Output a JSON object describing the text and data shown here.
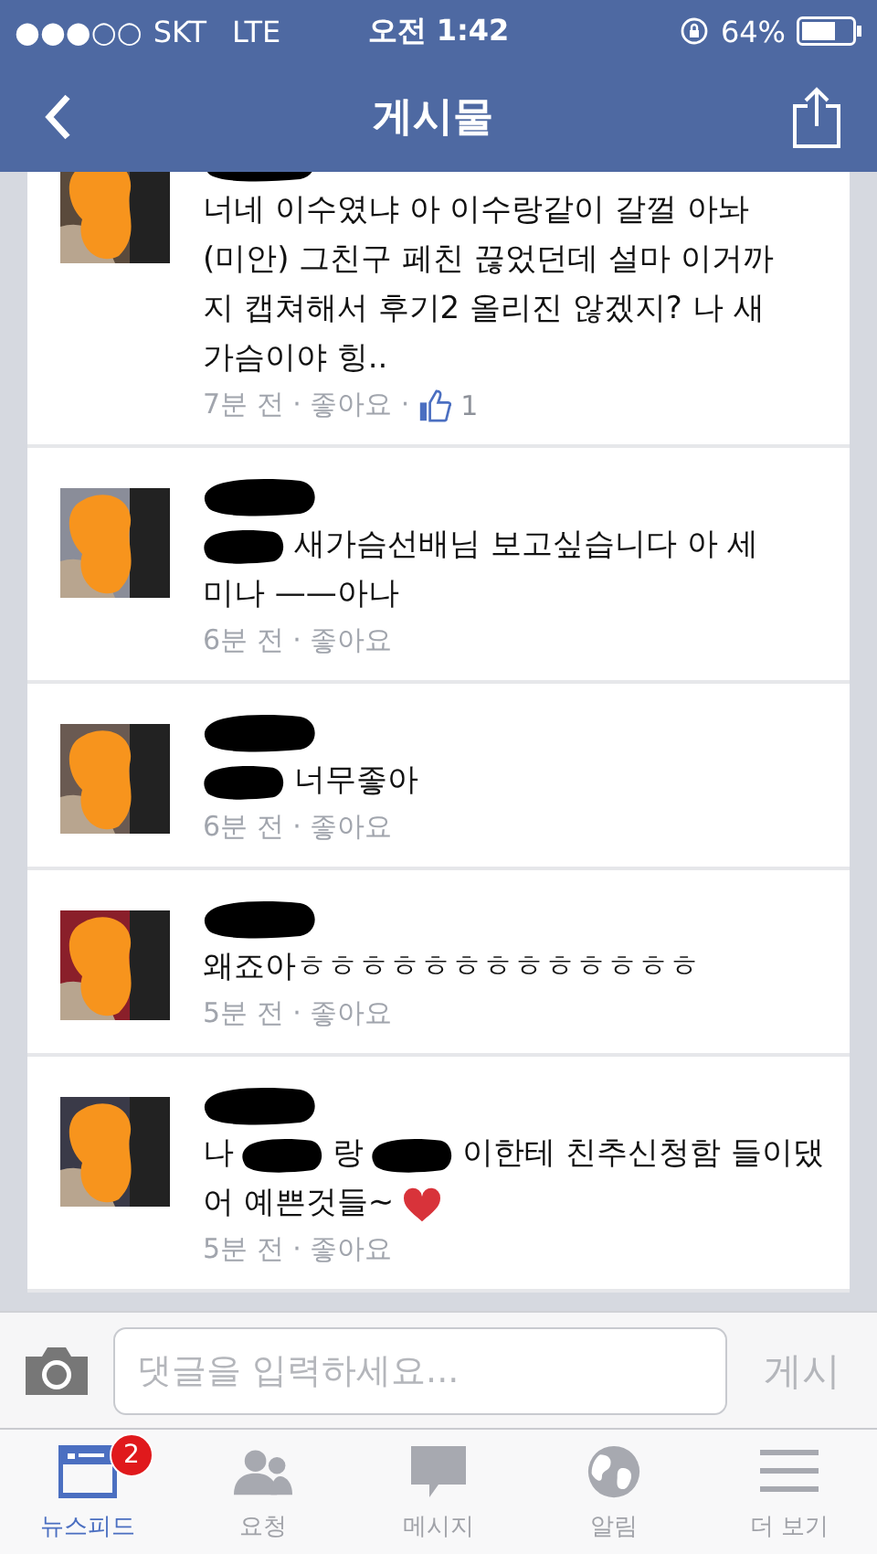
{
  "status_bar": {
    "signal": "●●●○○",
    "carrier": "SKT",
    "network": "LTE",
    "time": "오전 1:42",
    "battery": "64%"
  },
  "nav": {
    "title": "게시물"
  },
  "comments": [
    {
      "name_redacted": true,
      "lines": [
        [
          {
            "kind": "text",
            "text": "너네 이수였냐 아 이수랑같이 갈껄 아놔"
          }
        ],
        [
          {
            "kind": "text",
            "text": "(미안) 그친구 페친 끊었던데 설마 이거까"
          }
        ],
        [
          {
            "kind": "text",
            "text": "지 캡쳐해서 후기2 올리진 않겠지? 나 새"
          }
        ],
        [
          {
            "kind": "text",
            "text": "가슴이야 힝.."
          }
        ]
      ],
      "meta": "7분 전 · 좋아요 ·",
      "likes": "1"
    },
    {
      "name_redacted": true,
      "lines": [
        [
          {
            "kind": "redaction"
          },
          {
            "kind": "text",
            "text": "새가슴선배님 보고싶습니다 아 세"
          }
        ],
        [
          {
            "kind": "text",
            "text": "미나 ——아나"
          }
        ]
      ],
      "meta": "6분 전 · 좋아요"
    },
    {
      "name_redacted": true,
      "lines": [
        [
          {
            "kind": "redaction"
          },
          {
            "kind": "text",
            "text": "너무좋아"
          }
        ]
      ],
      "meta": "6분 전 · 좋아요"
    },
    {
      "name_redacted": true,
      "lines": [
        [
          {
            "kind": "text",
            "text": "왜죠아ㅎㅎㅎㅎㅎㅎㅎㅎㅎㅎㅎㅎㅎ"
          }
        ]
      ],
      "meta": "5분 전 · 좋아요"
    },
    {
      "name_redacted": true,
      "lines": [
        [
          {
            "kind": "text",
            "text": "나"
          },
          {
            "kind": "redaction"
          },
          {
            "kind": "text",
            "text": "랑"
          },
          {
            "kind": "redaction"
          },
          {
            "kind": "text",
            "text": "이한테 친추신청함 들이댔"
          }
        ],
        [
          {
            "kind": "text",
            "text": "어 예쁜것들~"
          },
          {
            "kind": "heart"
          }
        ]
      ],
      "meta": "5분 전 · 좋아요"
    }
  ],
  "composer": {
    "placeholder": "댓글을 입력하세요...",
    "post": "게시"
  },
  "tabs": [
    {
      "kind": "feed",
      "label": "뉴스피드",
      "selected": true,
      "badge": "2"
    },
    {
      "kind": "friends",
      "label": "요청",
      "selected": false
    },
    {
      "kind": "messages",
      "label": "메시지",
      "selected": false
    },
    {
      "kind": "globe",
      "label": "알림",
      "selected": false
    },
    {
      "kind": "more",
      "label": "더 보기",
      "selected": false
    }
  ]
}
